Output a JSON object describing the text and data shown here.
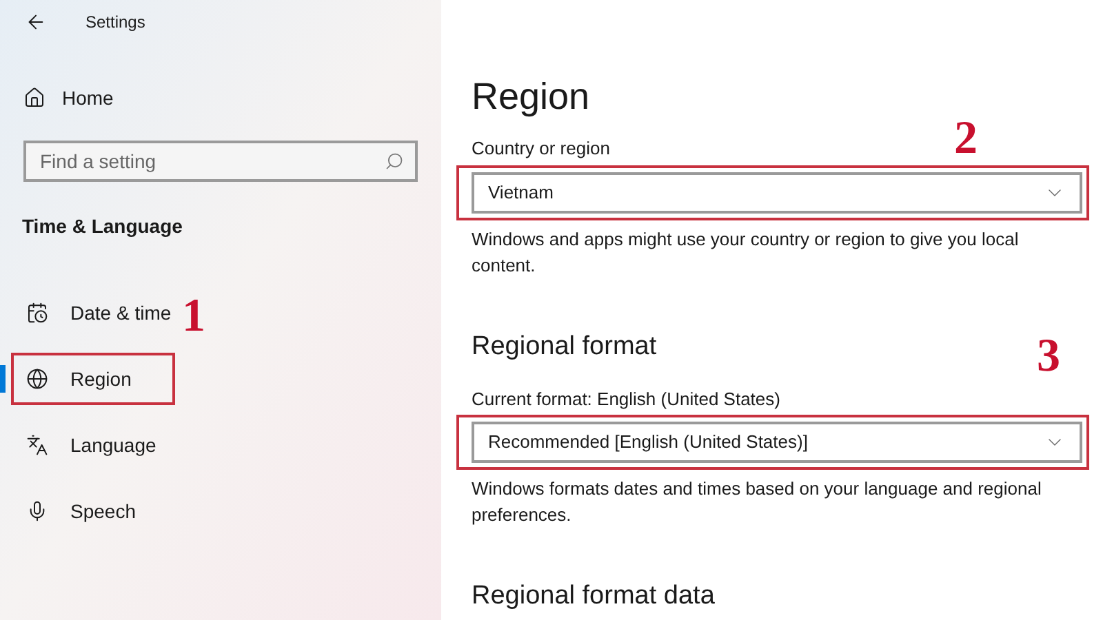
{
  "window": {
    "title": "Settings"
  },
  "sidebar": {
    "home": "Home",
    "search": {
      "placeholder": "Find a setting"
    },
    "section": "Time & Language",
    "items": [
      {
        "label": "Date & time",
        "selected": false,
        "highlighted": false
      },
      {
        "label": "Region",
        "selected": true,
        "highlighted": true,
        "callout": "1"
      },
      {
        "label": "Language",
        "selected": false,
        "highlighted": false
      },
      {
        "label": "Speech",
        "selected": false,
        "highlighted": false
      }
    ]
  },
  "page": {
    "title": "Region",
    "sections": [
      {
        "label": "Country or region",
        "dropdown": {
          "value": "Vietnam",
          "highlighted": true,
          "callout": "2"
        },
        "description": "Windows and apps might use your country or region to give you local content."
      },
      {
        "heading": "Regional format",
        "label": "Current format: English (United States)",
        "dropdown": {
          "value": "Recommended [English (United States)]",
          "highlighted": true,
          "callout": "3"
        },
        "description": "Windows formats dates and times based on your language and regional preferences."
      }
    ],
    "next_heading": "Regional format data"
  }
}
